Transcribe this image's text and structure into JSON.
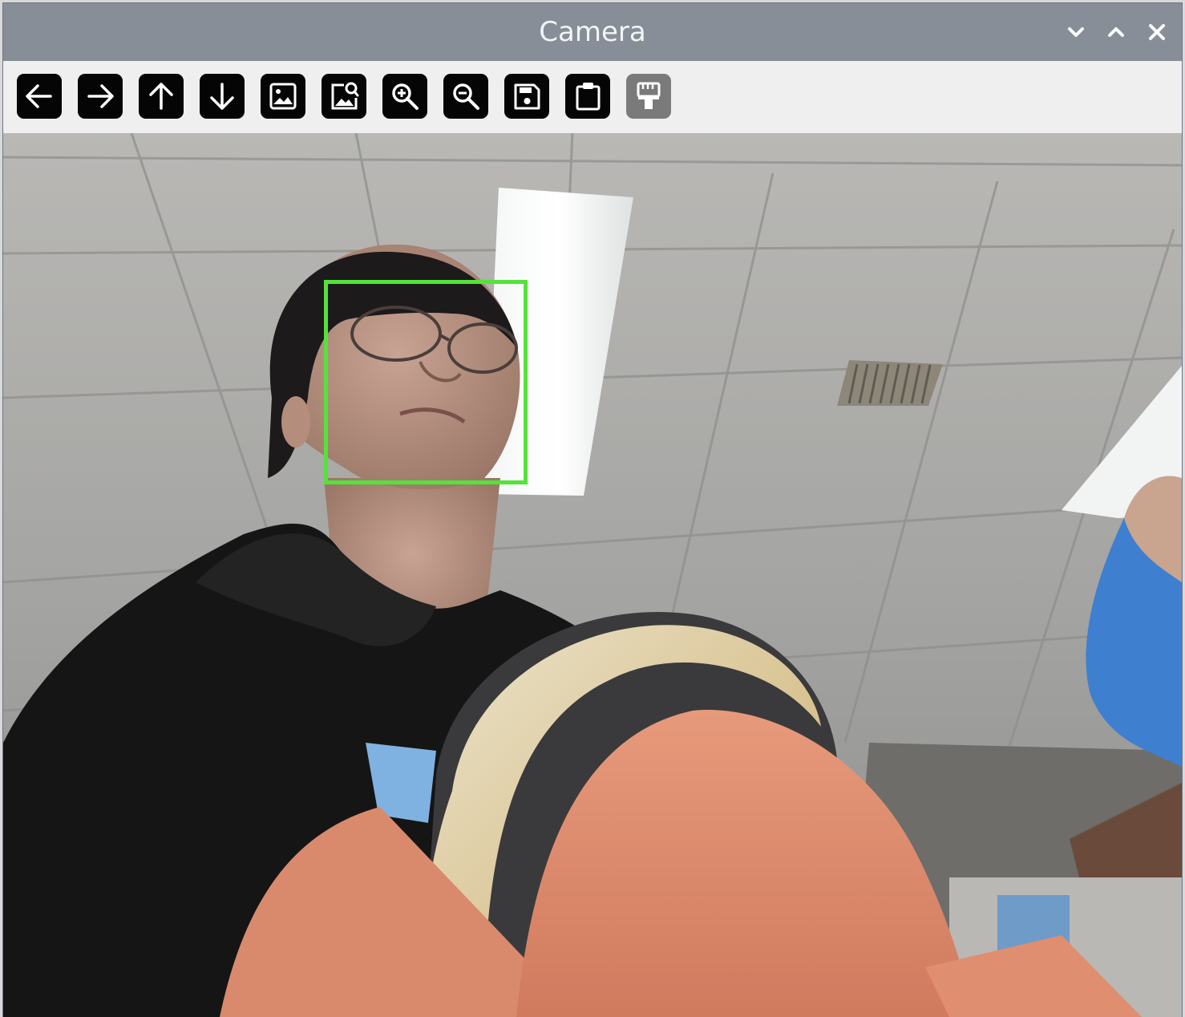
{
  "window": {
    "title": "Camera",
    "controls": [
      "minimize-icon",
      "maximize-icon",
      "close-icon"
    ]
  },
  "toolbar": {
    "buttons": [
      {
        "name": "back-button",
        "icon": "arrow-left-icon",
        "enabled": true
      },
      {
        "name": "forward-button",
        "icon": "arrow-right-icon",
        "enabled": true
      },
      {
        "name": "up-button",
        "icon": "arrow-up-icon",
        "enabled": true
      },
      {
        "name": "down-button",
        "icon": "arrow-down-icon",
        "enabled": true
      },
      {
        "name": "image-button",
        "icon": "image-icon",
        "enabled": true
      },
      {
        "name": "image-search-button",
        "icon": "image-search-icon",
        "enabled": true
      },
      {
        "name": "zoom-in-button",
        "icon": "zoom-in-icon",
        "enabled": true
      },
      {
        "name": "zoom-out-button",
        "icon": "zoom-out-icon",
        "enabled": true
      },
      {
        "name": "save-button",
        "icon": "save-icon",
        "enabled": true
      },
      {
        "name": "clipboard-button",
        "icon": "clipboard-icon",
        "enabled": true
      },
      {
        "name": "properties-button",
        "icon": "paint-brush-icon",
        "enabled": false
      }
    ]
  },
  "camera_view": {
    "face_detection_color": "#55e23a"
  }
}
